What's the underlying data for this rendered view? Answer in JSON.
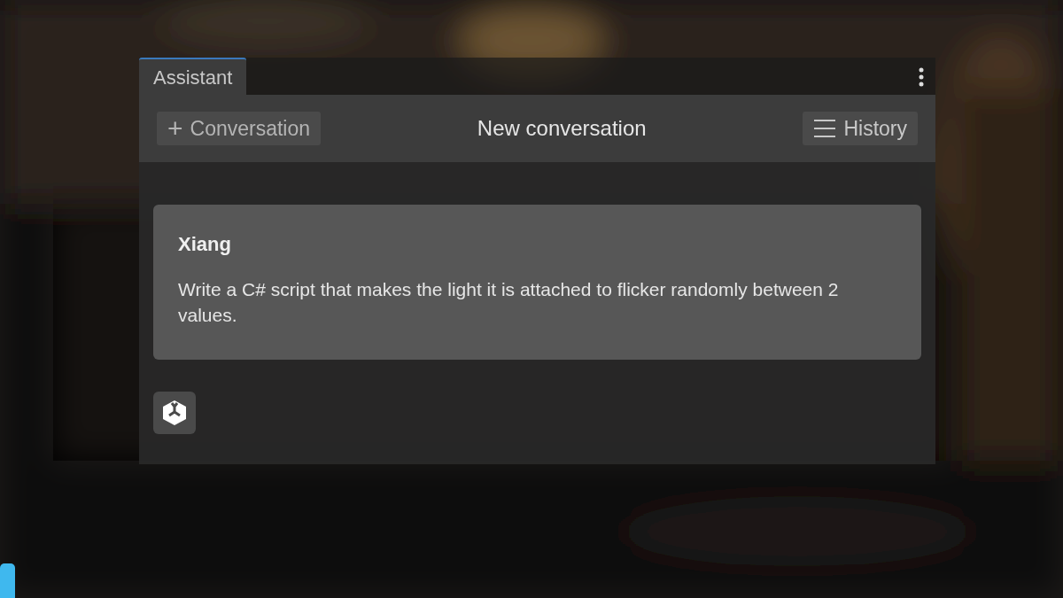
{
  "window": {
    "tab": "Assistant"
  },
  "toolbar": {
    "new_button": {
      "icon": "+",
      "label": "Conversation"
    },
    "title": "New conversation",
    "history_button": {
      "label": "History"
    }
  },
  "messages": [
    {
      "author": "Xiang",
      "text": "Write a C# script that makes the light it is attached to flicker randomly between 2 values."
    }
  ]
}
